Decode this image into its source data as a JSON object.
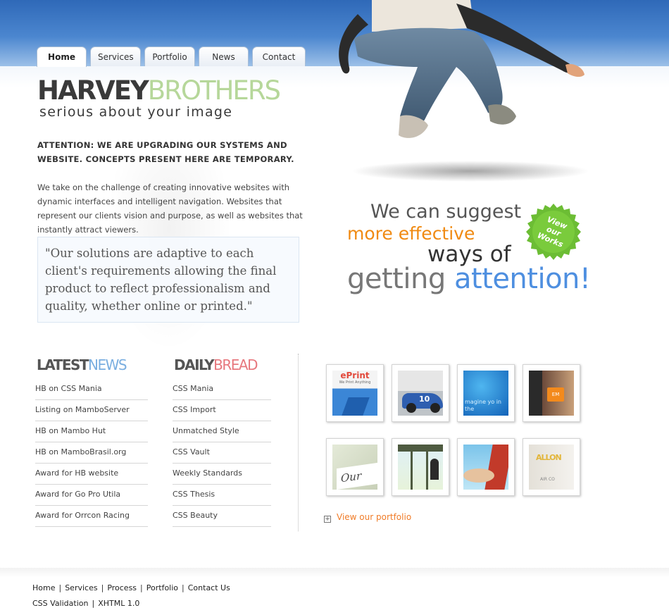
{
  "nav": {
    "tabs": [
      {
        "label": "Home",
        "active": true
      },
      {
        "label": "Services"
      },
      {
        "label": "Portfolio"
      },
      {
        "label": "News"
      },
      {
        "label": "Contact"
      }
    ]
  },
  "logo": {
    "part1": "HARVEY",
    "part2": "BROTHERS",
    "tagline": "serious about your image"
  },
  "main": {
    "attention": "ATTENTION: WE ARE UPGRADING OUR SYSTEMS AND WEBSITE. CONCEPTS PRESENT HERE ARE TEMPORARY.",
    "intro": "We take on the challenge of creating innovative websites with dynamic interfaces and intelligent navigation. Websites that represent our clients vision and purpose, as well as websites that instantly attract viewers.",
    "quote": "\"Our solutions are adaptive to each client's requirements allowing the final product to reflect professionalism and quality, whether online or printed.\""
  },
  "slogan": {
    "line1": "We can suggest",
    "line2": "more effective",
    "line3": "ways of",
    "line4a": "getting ",
    "line4b": "attention!",
    "seal_lines": [
      "View",
      "our",
      "Works"
    ]
  },
  "news": {
    "head_a": "LATEST",
    "head_b": "NEWS",
    "items": [
      "HB on CSS Mania",
      "Listing on MamboServer",
      "HB on Mambo Hut",
      "HB on MamboBrasil.org",
      "Award for HB website",
      "Award for Go Pro Utila",
      "Award for Orrcon Racing"
    ]
  },
  "bread": {
    "head_a": "DAILY",
    "head_b": "BREAD",
    "items": [
      "CSS Mania",
      "CSS Import",
      "Unmatched Style",
      "CSS Vault",
      "Weekly Standards",
      "CSS Thesis",
      "CSS Beauty"
    ]
  },
  "portfolio": {
    "thumb1_text": "ePrint",
    "thumb1_sub": "We Print Anything",
    "thumb2_text": "10",
    "thumb3_text": "magine yo in the",
    "thumb4_text": "EM",
    "thumb5_text": "Our",
    "thumb8_text": "ALLON",
    "thumb8_sub": "AIR CO",
    "link_label": "View our portfolio"
  },
  "footer": {
    "links": [
      "Home",
      "Services",
      "Process",
      "Portfolio",
      "Contact Us"
    ],
    "validation": [
      "CSS Validation",
      "XHTML 1.0"
    ]
  },
  "colors": {
    "header_blue": "#2f69b8",
    "accent_orange": "#f08a12",
    "accent_blue": "#4e8fe0",
    "logo_green": "#b6d79a",
    "bread_red": "#e7787e",
    "seal_green": "#6cbd34"
  }
}
